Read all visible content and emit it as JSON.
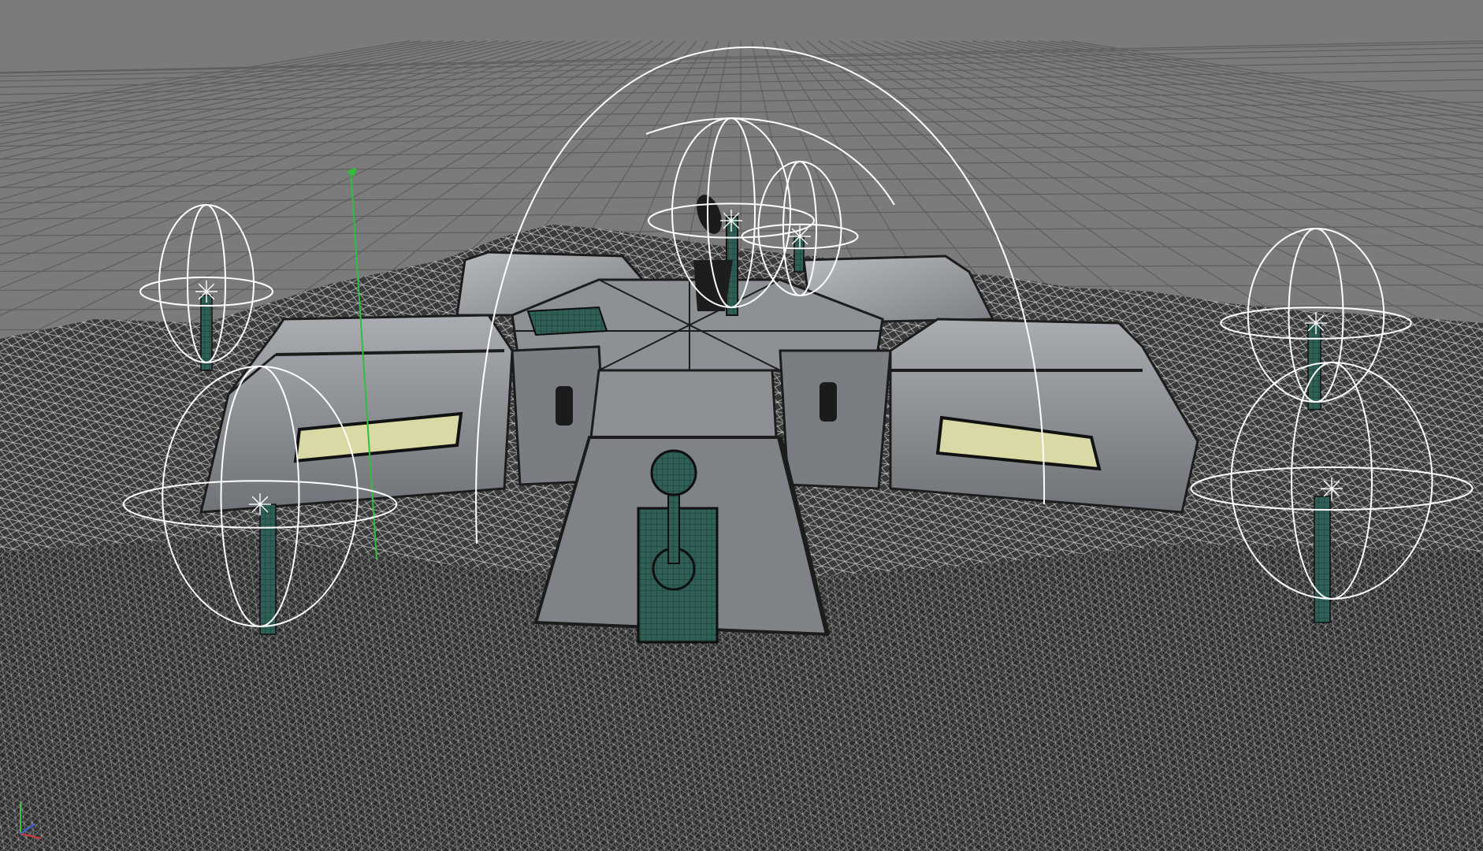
{
  "viewport": {
    "panel": "perspective-viewport",
    "background_color": "#7a7a7a",
    "grid_color": "#5f5f5f",
    "terrain_fill": "#2b2b2b",
    "terrain_wire": "#cfcfcf",
    "building_fill": "#8e9296",
    "building_dark": "#1c1c1c",
    "window_glow": "#d8d9a4",
    "mesh_teal": "#2f5f56",
    "light_gizmo_color": "#ffffff",
    "axis_y_color": "#2fbf3a"
  },
  "scene_objects": {
    "lights": [
      {
        "name": "point-light-left-top",
        "type": "point-light"
      },
      {
        "name": "point-light-left-bottom",
        "type": "point-light"
      },
      {
        "name": "point-light-center-top",
        "type": "point-light"
      },
      {
        "name": "point-light-center-small",
        "type": "point-light"
      },
      {
        "name": "point-light-right-top",
        "type": "point-light"
      },
      {
        "name": "point-light-right-bottom",
        "type": "point-light"
      },
      {
        "name": "dome-light-large",
        "type": "area-light"
      }
    ],
    "icons": {
      "axis_gizmo": "axis-triad-icon",
      "satellite_dish": "satellite-dish-icon"
    }
  }
}
